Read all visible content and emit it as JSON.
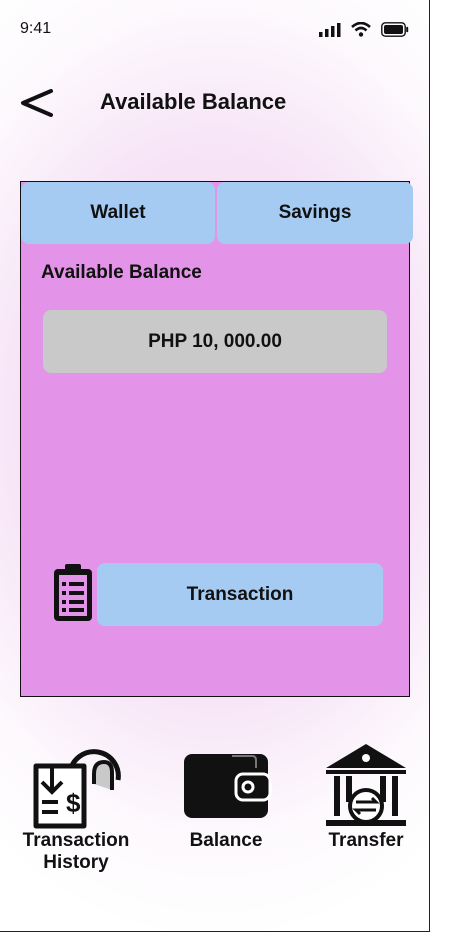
{
  "status_bar": {
    "time": "9:41"
  },
  "header": {
    "title": "Available Balance"
  },
  "tabs": [
    {
      "label": "Wallet"
    },
    {
      "label": "Savings"
    }
  ],
  "card": {
    "label": "Available Balance",
    "amount": "PHP  10, 000.00"
  },
  "transaction_button": {
    "label": "Transaction"
  },
  "bottom_nav": [
    {
      "label": "Transaction History",
      "icon": "transaction-history-icon"
    },
    {
      "label": "Balance",
      "icon": "wallet-icon"
    },
    {
      "label": "Transfer",
      "icon": "bank-transfer-icon"
    }
  ],
  "colors": {
    "card_bg": "#e393e8",
    "tab_bg": "#a6cbf2",
    "amount_bg": "#c9c9c9"
  }
}
